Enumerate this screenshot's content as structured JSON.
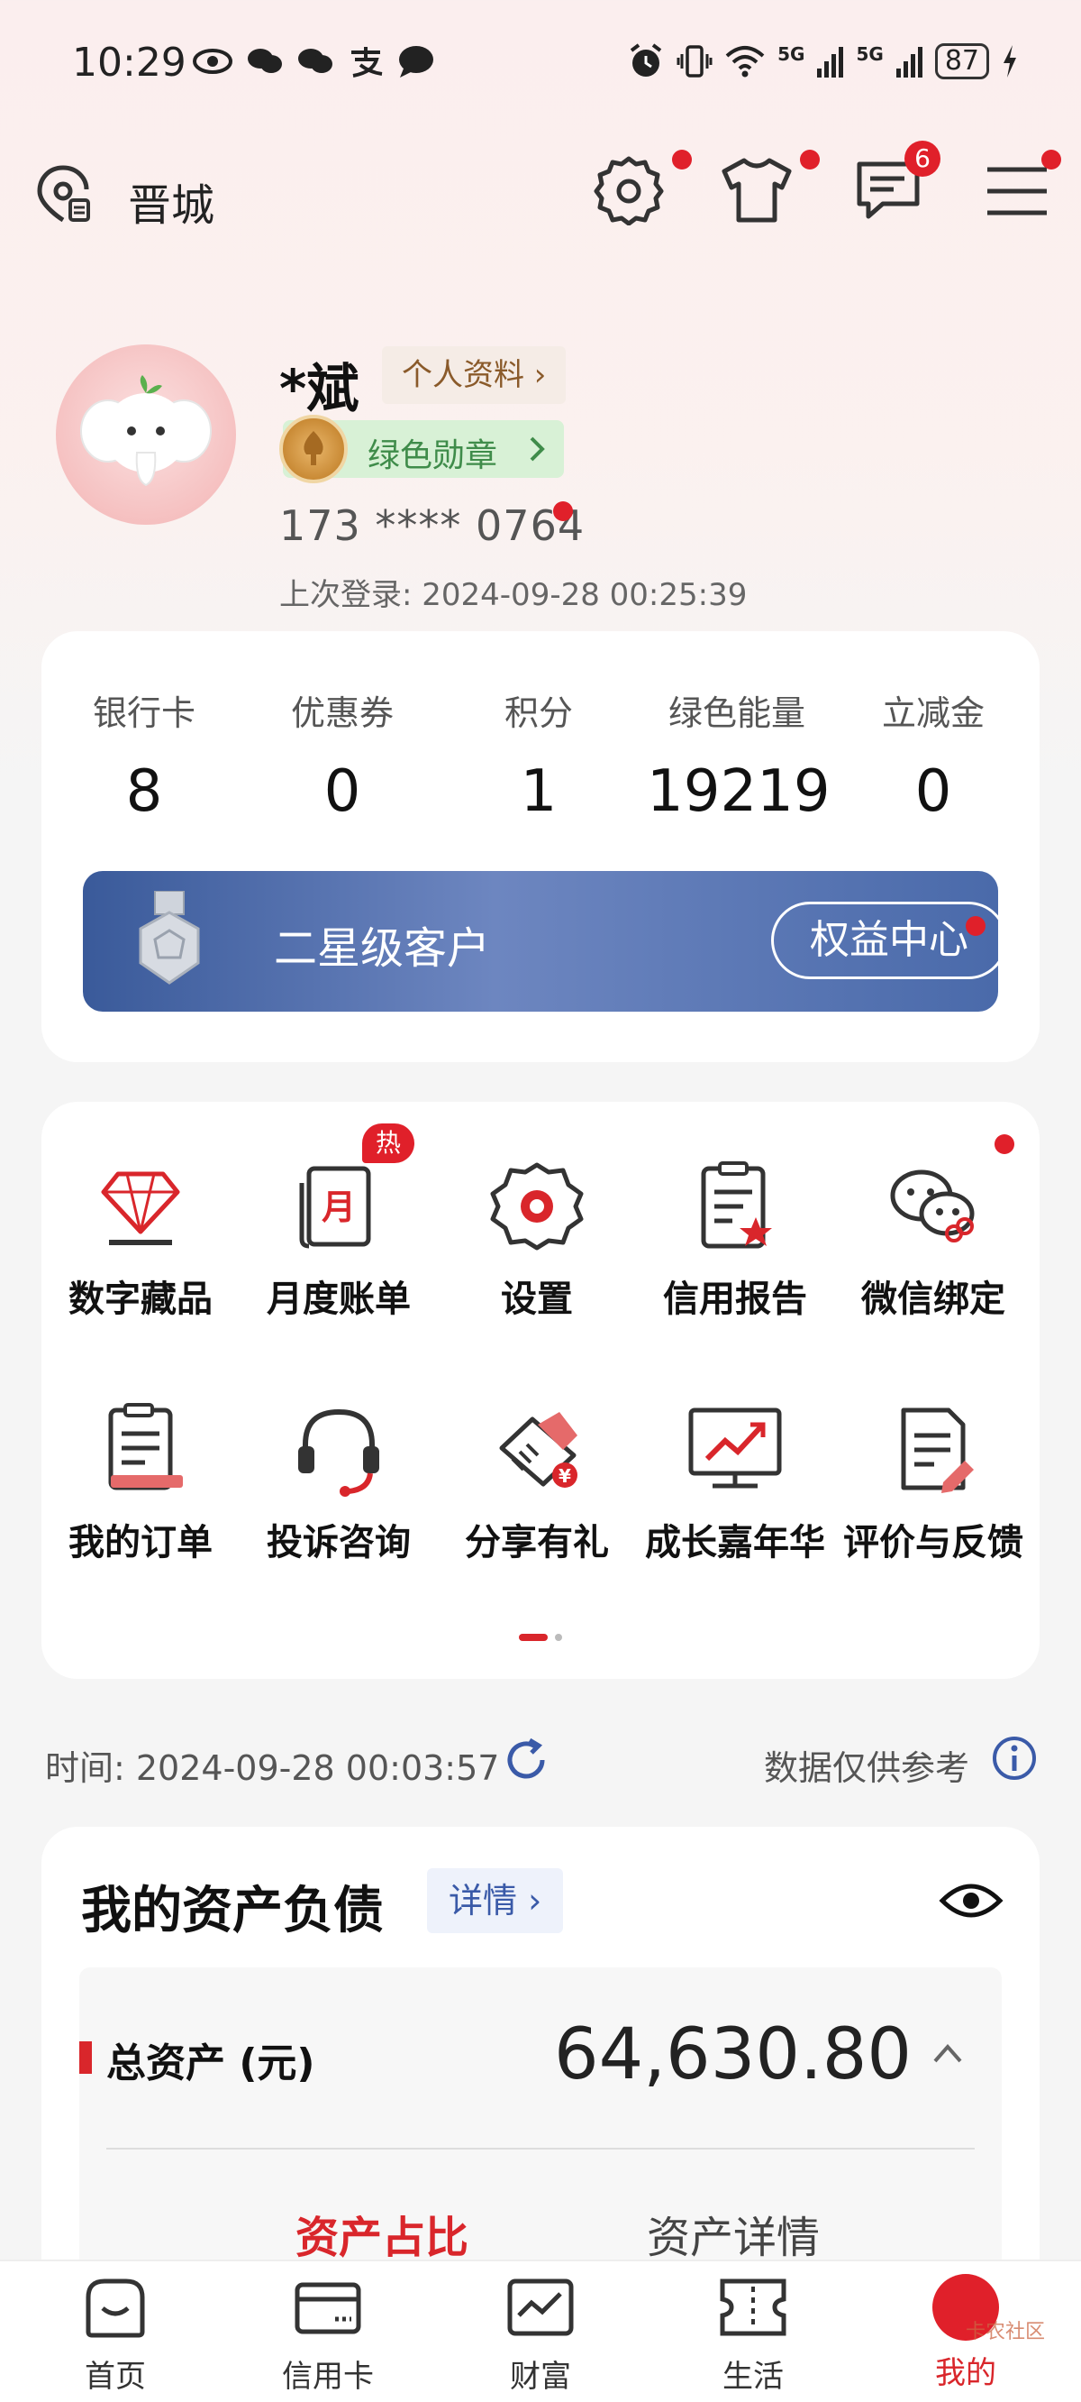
{
  "status_bar": {
    "time": "10:29",
    "network_1": "5G",
    "network_2": "5G",
    "battery": "87"
  },
  "header": {
    "location": "晋城",
    "message_badge": "6"
  },
  "profile": {
    "name": "*斌",
    "profile_link": "个人资料 ›",
    "medal_label": "绿色勋章",
    "phone": "173 **** 0764",
    "last_login": "上次登录: 2024-09-28 00:25:39"
  },
  "stats": [
    {
      "label": "银行卡",
      "value": "8"
    },
    {
      "label": "优惠券",
      "value": "0"
    },
    {
      "label": "积分",
      "value": "1"
    },
    {
      "label": "绿色能量",
      "value": "19219"
    },
    {
      "label": "立减金",
      "value": "0"
    }
  ],
  "tier": {
    "level": "二星级客户",
    "rights_button": "权益中心"
  },
  "functions": [
    {
      "label": "数字藏品",
      "icon": "diamond-icon"
    },
    {
      "label": "月度账单",
      "icon": "monthly-bill-icon",
      "badge": "热"
    },
    {
      "label": "设置",
      "icon": "settings-gear-icon"
    },
    {
      "label": "信用报告",
      "icon": "credit-report-icon"
    },
    {
      "label": "微信绑定",
      "icon": "wechat-link-icon"
    },
    {
      "label": "我的订单",
      "icon": "order-icon"
    },
    {
      "label": "投诉咨询",
      "icon": "headset-icon"
    },
    {
      "label": "分享有礼",
      "icon": "share-gift-icon"
    },
    {
      "label": "成长嘉年华",
      "icon": "growth-chart-icon"
    },
    {
      "label": "评价与反馈",
      "icon": "feedback-icon"
    }
  ],
  "info_row": {
    "time": "时间: 2024-09-28 00:03:57",
    "reference": "数据仅供参考"
  },
  "assets": {
    "title": "我的资产负债",
    "detail": "详情 ›",
    "total_label": "总资产 (元)",
    "total_value": "64,630.80",
    "tab_active": "资产占比",
    "tab_other": "资产详情"
  },
  "bottom_nav": [
    {
      "label": "首页",
      "icon": "home-icon"
    },
    {
      "label": "信用卡",
      "icon": "credit-card-icon"
    },
    {
      "label": "财富",
      "icon": "wealth-chart-icon"
    },
    {
      "label": "生活",
      "icon": "ticket-icon"
    },
    {
      "label": "我的",
      "icon": "me-icon",
      "active": true
    }
  ],
  "watermark": "卡农社区",
  "colors": {
    "brand_red": "#d9262b",
    "tier_blue": "#4a6aaa",
    "medal_green": "#3f8c4a"
  }
}
